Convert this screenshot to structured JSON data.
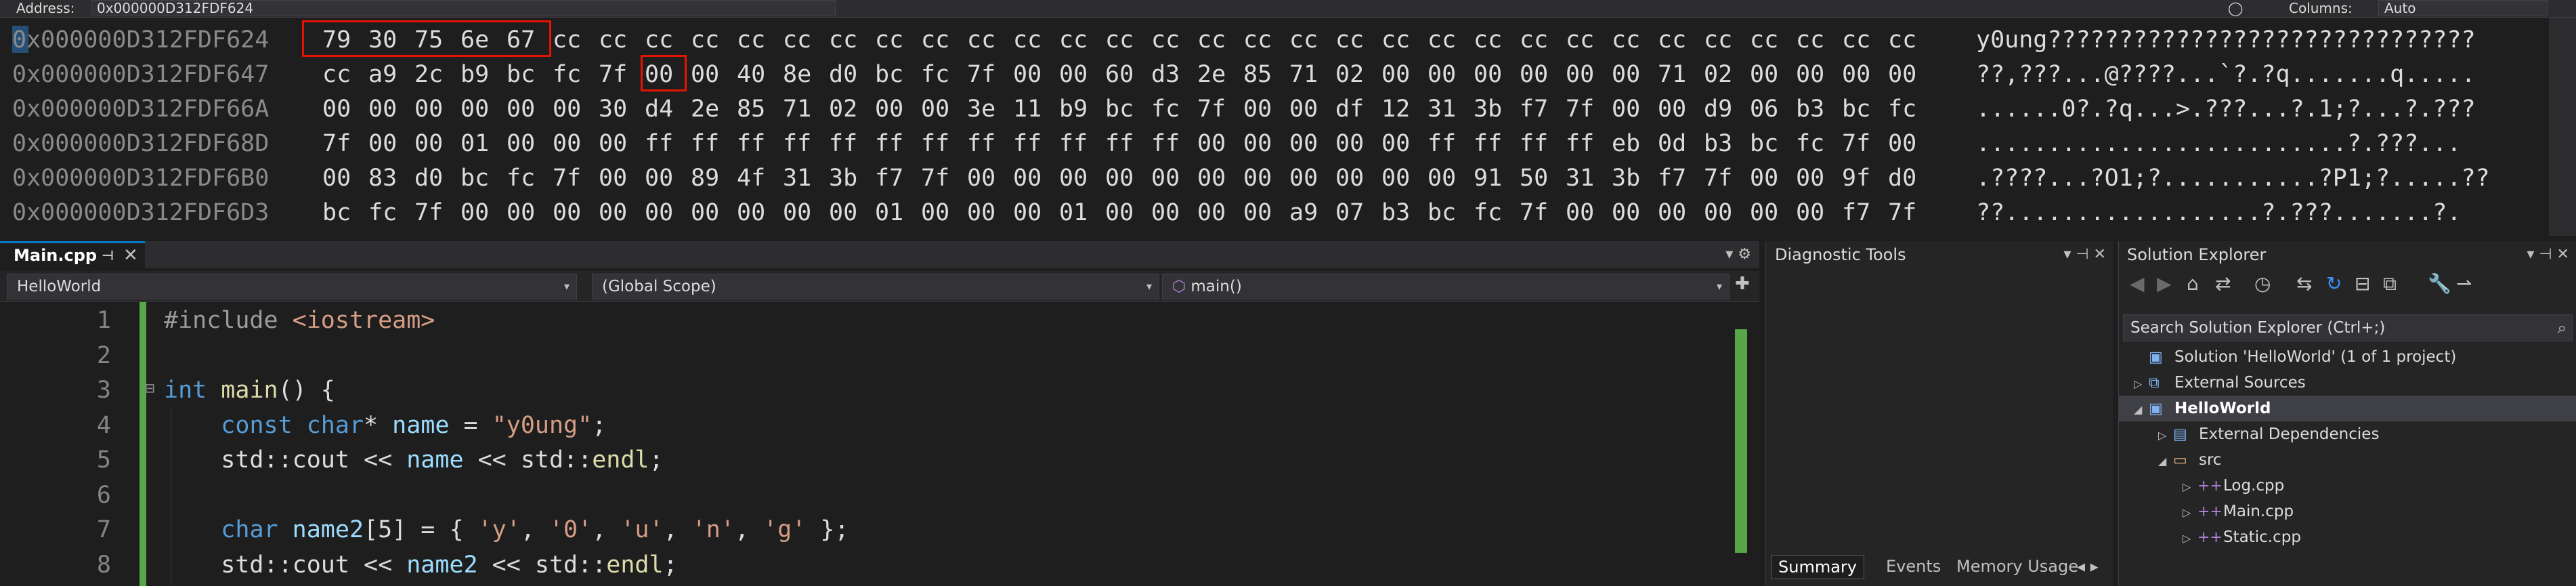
{
  "memory": {
    "address_label": "Address:",
    "address_value": "0x000000D312FDF624",
    "columns_label": "Columns:",
    "columns_value": "Auto",
    "rows": [
      {
        "addr": "0x000000D312FDF624",
        "hex": [
          "79",
          "30",
          "75",
          "6e",
          "67",
          "cc",
          "cc",
          "cc",
          "cc",
          "cc",
          "cc",
          "cc",
          "cc",
          "cc",
          "cc",
          "cc",
          "cc",
          "cc",
          "cc",
          "cc",
          "cc",
          "cc",
          "cc",
          "cc",
          "cc",
          "cc",
          "cc",
          "cc",
          "cc",
          "cc",
          "cc",
          "cc",
          "cc",
          "cc",
          "cc"
        ],
        "ascii": "y0ung??????????????????????????????"
      },
      {
        "addr": "0x000000D312FDF647",
        "hex": [
          "cc",
          "a9",
          "2c",
          "b9",
          "bc",
          "fc",
          "7f",
          "00",
          "00",
          "40",
          "8e",
          "d0",
          "bc",
          "fc",
          "7f",
          "00",
          "00",
          "60",
          "d3",
          "2e",
          "85",
          "71",
          "02",
          "00",
          "00",
          "00",
          "00",
          "00",
          "00",
          "71",
          "02",
          "00",
          "00",
          "00",
          "00"
        ],
        "ascii": "??,???...@????...`?.?q.......q....."
      },
      {
        "addr": "0x000000D312FDF66A",
        "hex": [
          "00",
          "00",
          "00",
          "00",
          "00",
          "00",
          "30",
          "d4",
          "2e",
          "85",
          "71",
          "02",
          "00",
          "00",
          "3e",
          "11",
          "b9",
          "bc",
          "fc",
          "7f",
          "00",
          "00",
          "df",
          "12",
          "31",
          "3b",
          "f7",
          "7f",
          "00",
          "00",
          "d9",
          "06",
          "b3",
          "bc",
          "fc"
        ],
        "ascii": "......0?.?q...>.???...?.1;?...?.???"
      },
      {
        "addr": "0x000000D312FDF68D",
        "hex": [
          "7f",
          "00",
          "00",
          "01",
          "00",
          "00",
          "00",
          "ff",
          "ff",
          "ff",
          "ff",
          "ff",
          "ff",
          "ff",
          "ff",
          "ff",
          "ff",
          "ff",
          "ff",
          "00",
          "00",
          "00",
          "00",
          "00",
          "ff",
          "ff",
          "ff",
          "ff",
          "eb",
          "0d",
          "b3",
          "bc",
          "fc",
          "7f",
          "00",
          "00"
        ],
        "ascii": "..........................?.???..."
      },
      {
        "addr": "0x000000D312FDF6B0",
        "hex": [
          "00",
          "83",
          "d0",
          "bc",
          "fc",
          "7f",
          "00",
          "00",
          "89",
          "4f",
          "31",
          "3b",
          "f7",
          "7f",
          "00",
          "00",
          "00",
          "00",
          "00",
          "00",
          "00",
          "00",
          "00",
          "00",
          "00",
          "91",
          "50",
          "31",
          "3b",
          "f7",
          "7f",
          "00",
          "00",
          "9f",
          "d0"
        ],
        "ascii": ".????...?O1;?...........?P1;?.....??"
      },
      {
        "addr": "0x000000D312FDF6D3",
        "hex": [
          "bc",
          "fc",
          "7f",
          "00",
          "00",
          "00",
          "00",
          "00",
          "00",
          "00",
          "00",
          "00",
          "01",
          "00",
          "00",
          "00",
          "01",
          "00",
          "00",
          "00",
          "00",
          "a9",
          "07",
          "b3",
          "bc",
          "fc",
          "7f",
          "00",
          "00",
          "00",
          "00",
          "00",
          "00",
          "f7",
          "7f"
        ],
        "ascii": "??..................?.???.......?."
      }
    ]
  },
  "editor": {
    "tab_label": "Main.cpp",
    "tab_pin": "⊣",
    "tab_close": "✕",
    "tab_menu": "▾ ⚙",
    "nav_project": "HelloWorld",
    "nav_scope": "(Global Scope)",
    "nav_member": "main()",
    "lines": [
      {
        "n": "1",
        "tokens": [
          [
            "tok-pre",
            "#include "
          ],
          [
            "tok-str",
            "<iostream>"
          ]
        ]
      },
      {
        "n": "2",
        "tokens": []
      },
      {
        "n": "3",
        "tokens": [
          [
            "tok-kw",
            "int "
          ],
          [
            "tok-fn",
            "main"
          ],
          [
            "tok-plain",
            "() {"
          ]
        ]
      },
      {
        "n": "4",
        "tokens": [
          [
            "tok-plain",
            "    "
          ],
          [
            "tok-kw",
            "const char"
          ],
          [
            "tok-plain",
            "* "
          ],
          [
            "tok-var",
            "name"
          ],
          [
            "tok-plain",
            " = "
          ],
          [
            "tok-str",
            "\"y0ung\""
          ],
          [
            "tok-plain",
            ";"
          ]
        ]
      },
      {
        "n": "5",
        "tokens": [
          [
            "tok-plain",
            "    std::cout << "
          ],
          [
            "tok-var",
            "name"
          ],
          [
            "tok-plain",
            " << std::"
          ],
          [
            "tok-fn",
            "endl"
          ],
          [
            "tok-plain",
            ";"
          ]
        ]
      },
      {
        "n": "6",
        "tokens": []
      },
      {
        "n": "7",
        "tokens": [
          [
            "tok-plain",
            "    "
          ],
          [
            "tok-kw",
            "char "
          ],
          [
            "tok-var",
            "name2"
          ],
          [
            "tok-plain",
            "[5] = { "
          ],
          [
            "tok-str",
            "'y'"
          ],
          [
            "tok-plain",
            ", "
          ],
          [
            "tok-str",
            "'0'"
          ],
          [
            "tok-plain",
            ", "
          ],
          [
            "tok-str",
            "'u'"
          ],
          [
            "tok-plain",
            ", "
          ],
          [
            "tok-str",
            "'n'"
          ],
          [
            "tok-plain",
            ", "
          ],
          [
            "tok-str",
            "'g'"
          ],
          [
            "tok-plain",
            " };"
          ]
        ]
      },
      {
        "n": "8",
        "tokens": [
          [
            "tok-plain",
            "    std::cout << "
          ],
          [
            "tok-var",
            "name2"
          ],
          [
            "tok-plain",
            " << std::"
          ],
          [
            "tok-fn",
            "endl"
          ],
          [
            "tok-plain",
            ";"
          ]
        ]
      }
    ]
  },
  "diagnostic": {
    "title": "Diagnostic Tools",
    "header_buttons": "▾ ⊣ ✕",
    "tabs": [
      "Summary",
      "Events",
      "Memory Usage"
    ],
    "tab_arrows": "◂ ▸"
  },
  "solution": {
    "title": "Solution Explorer",
    "header_buttons": "▾ ⊣ ✕",
    "search_placeholder": "Search Solution Explorer (Ctrl+;)",
    "items": [
      {
        "label": "Solution 'HelloWorld' (1 of 1 project)",
        "exp": "",
        "icon": "▣",
        "indent": 0,
        "bold": false
      },
      {
        "label": "External Sources",
        "exp": "▷",
        "icon": "⧉",
        "indent": 0,
        "bold": false
      },
      {
        "label": "HelloWorld",
        "exp": "◢",
        "icon": "▣",
        "indent": 0,
        "bold": true
      },
      {
        "label": "External Dependencies",
        "exp": "▷",
        "icon": "▤",
        "indent": 1,
        "bold": false
      },
      {
        "label": "src",
        "exp": "◢",
        "icon": "▭",
        "indent": 1,
        "bold": false
      },
      {
        "label": "Log.cpp",
        "exp": "▷",
        "icon": "++",
        "indent": 2,
        "bold": false
      },
      {
        "label": "Main.cpp",
        "exp": "▷",
        "icon": "++",
        "indent": 2,
        "bold": false
      },
      {
        "label": "Static.cpp",
        "exp": "▷",
        "icon": "++",
        "indent": 2,
        "bold": false
      }
    ]
  },
  "colors": {
    "accent": "#007acc",
    "highlight_box": "#e51400",
    "change_bar": "#57a64a"
  }
}
